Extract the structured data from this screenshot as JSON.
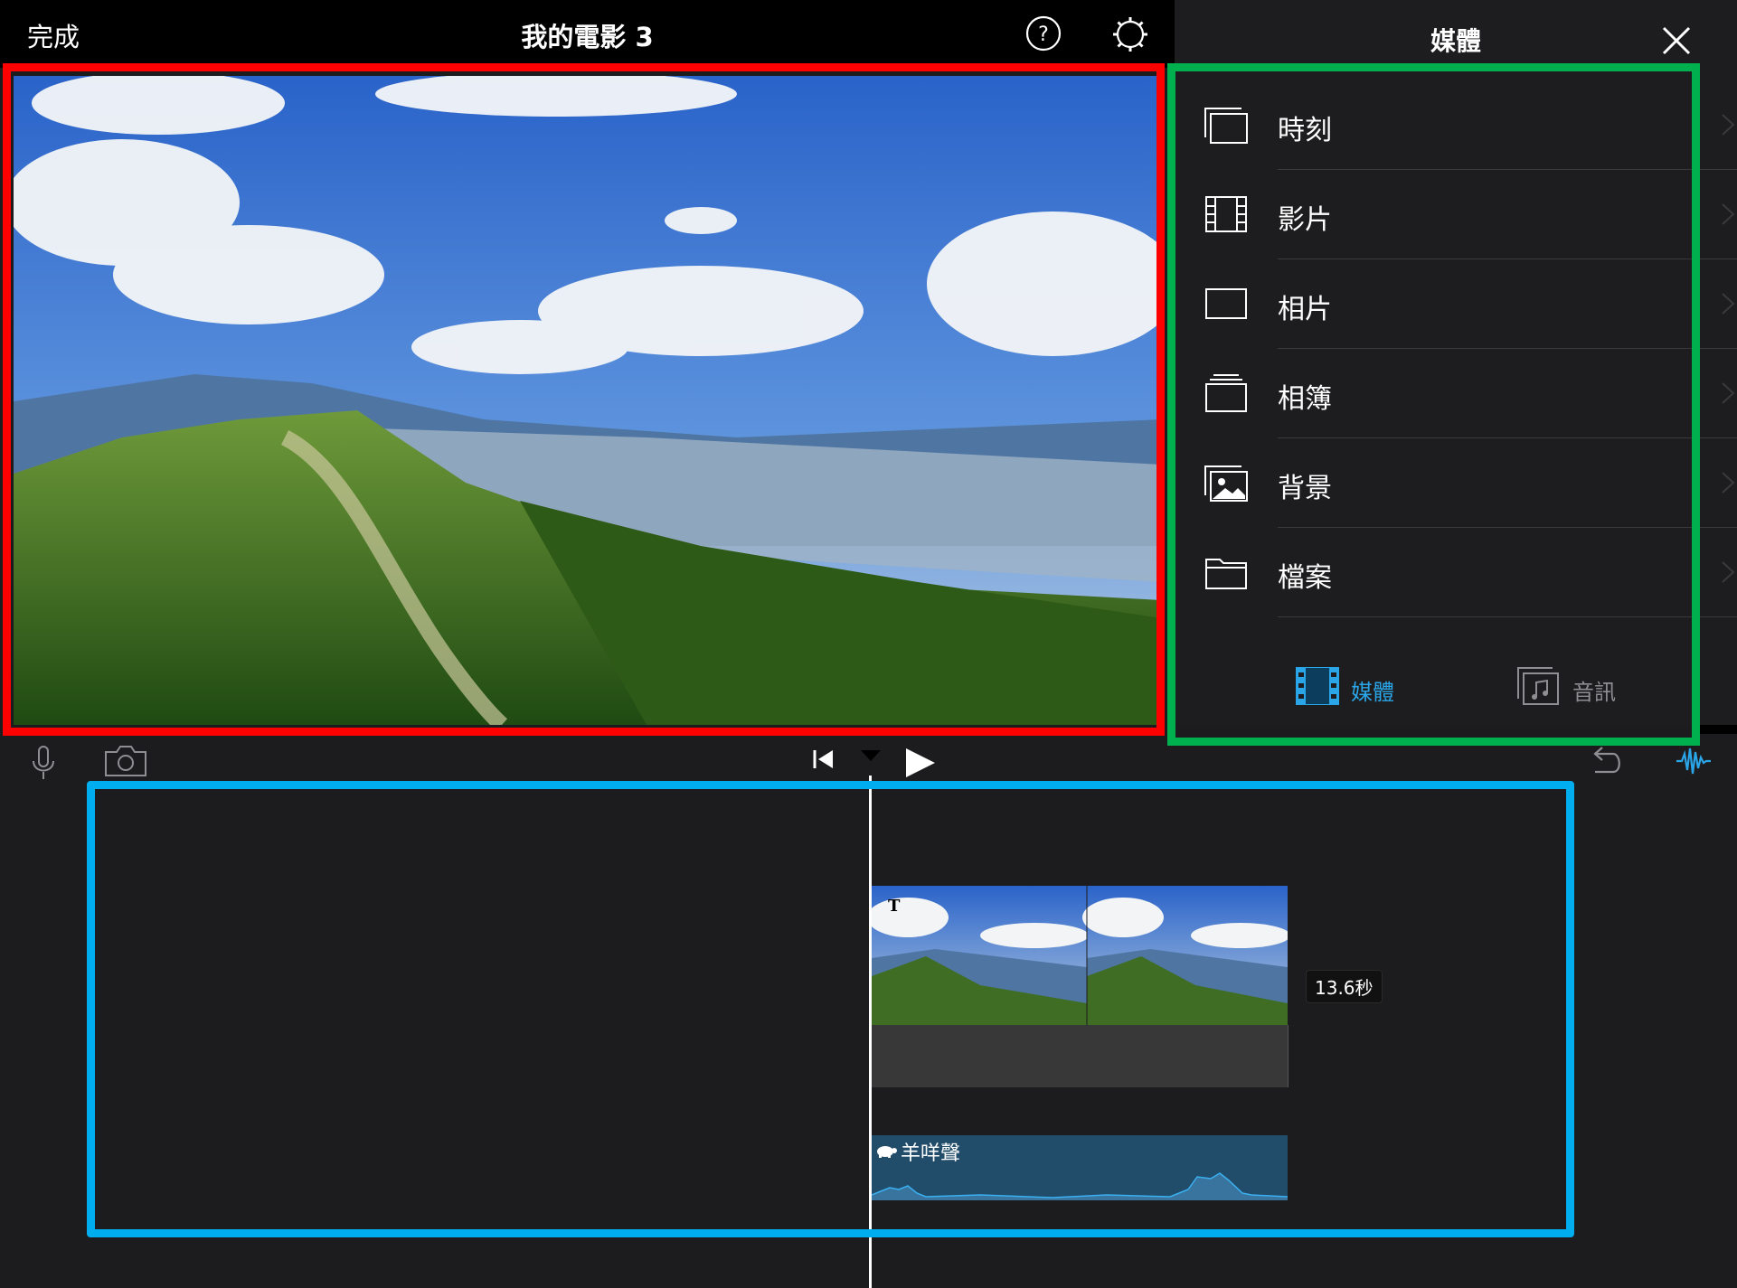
{
  "topbar": {
    "done_label": "完成",
    "title": "我的電影 3",
    "help_icon": "help-icon",
    "settings_icon": "gear-icon"
  },
  "panel": {
    "title": "媒體",
    "close_icon": "close-icon",
    "items": [
      {
        "label": "時刻",
        "icon": "moments-icon"
      },
      {
        "label": "影片",
        "icon": "film-icon"
      },
      {
        "label": "相片",
        "icon": "photo-frame-icon"
      },
      {
        "label": "相簿",
        "icon": "album-icon"
      },
      {
        "label": "背景",
        "icon": "background-image-icon"
      },
      {
        "label": "檔案",
        "icon": "folder-icon"
      }
    ],
    "tabs": [
      {
        "label": "媒體",
        "icon": "media-tab-icon",
        "active": true
      },
      {
        "label": "音訊",
        "icon": "audio-tab-icon",
        "active": false
      }
    ]
  },
  "toolbar": {
    "mic_icon": "microphone-icon",
    "camera_icon": "camera-icon",
    "skip_back_icon": "skip-to-start-icon",
    "play_icon": "play-icon",
    "undo_icon": "undo-icon",
    "waveform_icon": "audio-waveform-icon"
  },
  "timeline": {
    "clip_title_marker": "T",
    "clip_duration": "13.6秒",
    "audio_clip_label": "羊咩聲",
    "audio_clip_icon": "turtle-icon"
  },
  "colors": {
    "accent_blue": "#2aa6e8",
    "annotation_red": "#ff0000",
    "annotation_green": "#00b04f",
    "annotation_blue": "#00aeef",
    "audio_clip_bg": "#214d6b"
  }
}
